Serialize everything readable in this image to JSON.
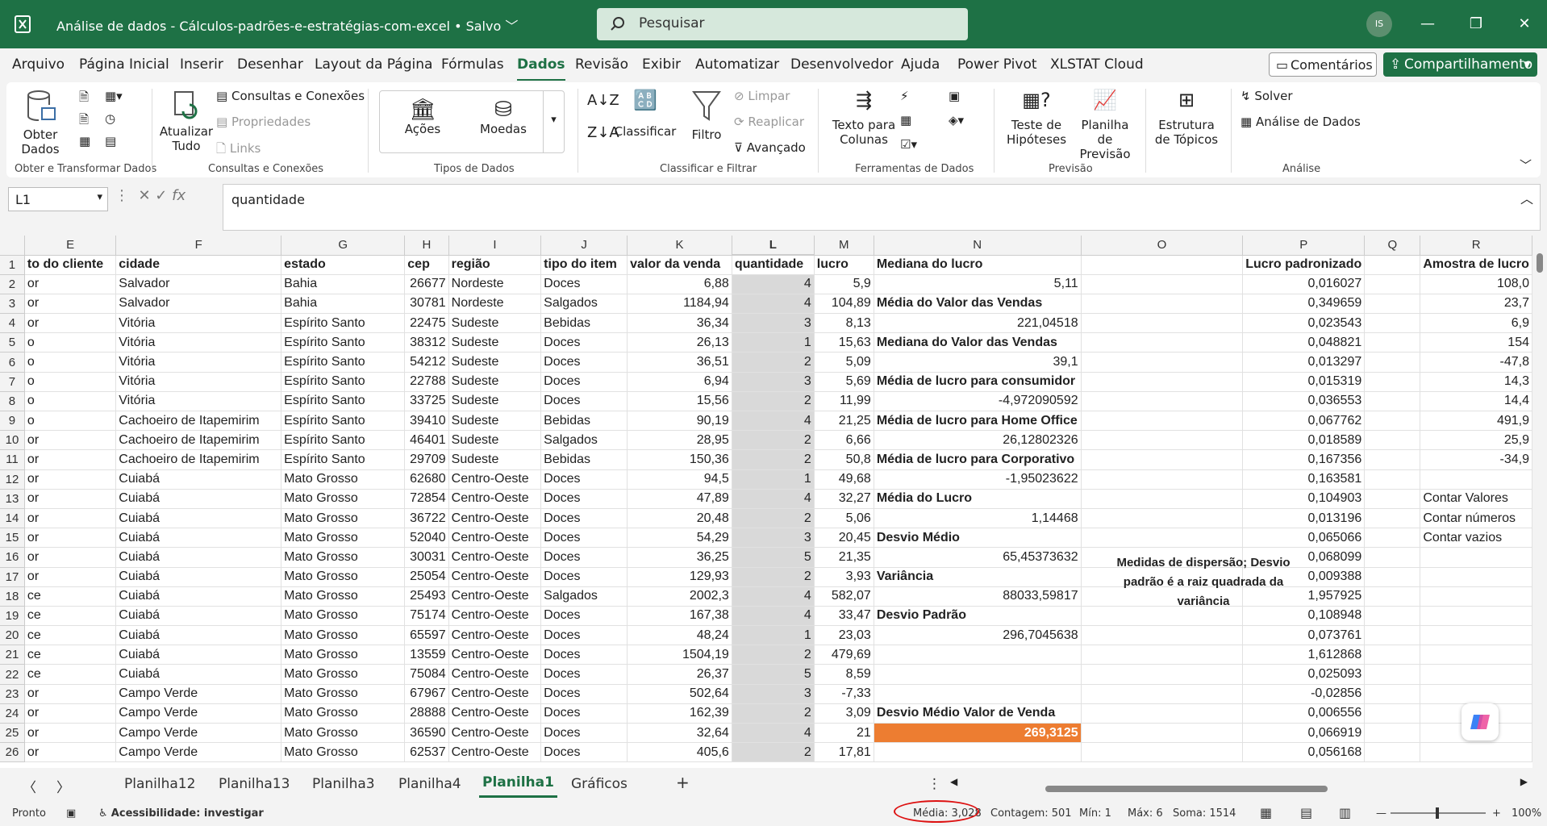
{
  "window": {
    "title": "Análise de dados - Cálculos-padrões-e-estratégias-com-excel • Salvo",
    "avatar": "IS"
  },
  "search": {
    "placeholder": "Pesquisar"
  },
  "menu": {
    "tabs": [
      "Arquivo",
      "Página Inicial",
      "Inserir",
      "Desenhar",
      "Layout da Página",
      "Fórmulas",
      "Dados",
      "Revisão",
      "Exibir",
      "Automatizar",
      "Desenvolvedor",
      "Ajuda",
      "Power Pivot",
      "XLSTAT Cloud"
    ],
    "active": "Dados",
    "comments": "Comentários",
    "share": "Compartilhamento"
  },
  "ribbon": {
    "get_data": "Obter Dados",
    "refresh_all": "Atualizar Tudo",
    "queries": "Consultas e Conexões",
    "properties": "Propriedades",
    "links": "Links",
    "stocks": "Ações",
    "currencies": "Moedas",
    "sort": "Classificar",
    "filter": "Filtro",
    "clear": "Limpar",
    "reapply": "Reaplicar",
    "advanced": "Avançado",
    "text_to_columns": "Texto para Colunas",
    "what_if": "Teste de Hipóteses",
    "forecast": "Planilha de Previsão",
    "outline": "Estrutura de Tópicos",
    "solver": "Solver",
    "data_analysis": "Análise de Dados",
    "groups": [
      "Obter e Transformar Dados",
      "Consultas e Conexões",
      "Tipos de Dados",
      "Classificar e Filtrar",
      "Ferramentas de Dados",
      "Previsão",
      "Análise"
    ]
  },
  "formula_bar": {
    "name_box": "L1",
    "formula": "quantidade"
  },
  "sheet": {
    "columns": [
      "E",
      "F",
      "G",
      "H",
      "I",
      "J",
      "K",
      "L",
      "M",
      "N",
      "O",
      "P",
      "Q",
      "R"
    ],
    "selected_column": "L",
    "rows": [
      [
        "to do cliente",
        "cidade",
        "estado",
        "cep",
        "região",
        "tipo do item",
        "valor da venda",
        "quantidade",
        "lucro",
        "Mediana do lucro",
        "",
        "Lucro padronizado",
        "",
        "Amostra de lucro"
      ],
      [
        "or",
        "Salvador",
        "Bahia",
        "26677",
        "Nordeste",
        "Doces",
        "6,88",
        "4",
        "5,9",
        "5,11",
        "",
        "0,016027",
        "",
        "108,0"
      ],
      [
        "or",
        "Salvador",
        "Bahia",
        "30781",
        "Nordeste",
        "Salgados",
        "1184,94",
        "4",
        "104,89",
        "Média do Valor das Vendas",
        "",
        "0,349659",
        "",
        "23,7"
      ],
      [
        "or",
        "Vitória",
        "Espírito Santo",
        "22475",
        "Sudeste",
        "Bebidas",
        "36,34",
        "3",
        "8,13",
        "221,04518",
        "",
        "0,023543",
        "",
        "6,9"
      ],
      [
        "o",
        "Vitória",
        "Espírito Santo",
        "38312",
        "Sudeste",
        "Doces",
        "26,13",
        "1",
        "15,63",
        "Mediana do Valor das Vendas",
        "",
        "0,048821",
        "",
        "154"
      ],
      [
        "o",
        "Vitória",
        "Espírito Santo",
        "54212",
        "Sudeste",
        "Doces",
        "36,51",
        "2",
        "5,09",
        "39,1",
        "",
        "0,013297",
        "",
        "-47,8"
      ],
      [
        "o",
        "Vitória",
        "Espírito Santo",
        "22788",
        "Sudeste",
        "Doces",
        "6,94",
        "3",
        "5,69",
        "Média de lucro para consumidor",
        "",
        "0,015319",
        "",
        "14,3"
      ],
      [
        "o",
        "Vitória",
        "Espírito Santo",
        "33725",
        "Sudeste",
        "Doces",
        "15,56",
        "2",
        "11,99",
        "-4,972090592",
        "",
        "0,036553",
        "",
        "14,4"
      ],
      [
        "o",
        "Cachoeiro de Itapemirim",
        "Espírito Santo",
        "39410",
        "Sudeste",
        "Bebidas",
        "90,19",
        "4",
        "21,25",
        "Média de lucro para Home Office",
        "",
        "0,067762",
        "",
        "491,9"
      ],
      [
        "or",
        "Cachoeiro de Itapemirim",
        "Espírito Santo",
        "46401",
        "Sudeste",
        "Salgados",
        "28,95",
        "2",
        "6,66",
        "26,12802326",
        "",
        "0,018589",
        "",
        "25,9"
      ],
      [
        "or",
        "Cachoeiro de Itapemirim",
        "Espírito Santo",
        "29709",
        "Sudeste",
        "Bebidas",
        "150,36",
        "2",
        "50,8",
        "Média de lucro para Corporativo",
        "",
        "0,167356",
        "",
        "-34,9"
      ],
      [
        "or",
        "Cuiabá",
        "Mato Grosso",
        "62680",
        "Centro-Oeste",
        "Doces",
        "94,5",
        "1",
        "49,68",
        "-1,95023622",
        "",
        "0,163581",
        "",
        ""
      ],
      [
        "or",
        "Cuiabá",
        "Mato Grosso",
        "72854",
        "Centro-Oeste",
        "Doces",
        "47,89",
        "4",
        "32,27",
        "Média do Lucro",
        "",
        "0,104903",
        "",
        "Contar Valores"
      ],
      [
        "or",
        "Cuiabá",
        "Mato Grosso",
        "36722",
        "Centro-Oeste",
        "Doces",
        "20,48",
        "2",
        "5,06",
        "1,14468",
        "",
        "0,013196",
        "",
        "Contar números"
      ],
      [
        "or",
        "Cuiabá",
        "Mato Grosso",
        "52040",
        "Centro-Oeste",
        "Doces",
        "54,29",
        "3",
        "20,45",
        "Desvio Médio",
        "",
        "0,065066",
        "",
        "Contar vazios"
      ],
      [
        "or",
        "Cuiabá",
        "Mato Grosso",
        "30031",
        "Centro-Oeste",
        "Doces",
        "36,25",
        "5",
        "21,35",
        "65,45373632",
        "",
        "0,068099",
        "",
        ""
      ],
      [
        "or",
        "Cuiabá",
        "Mato Grosso",
        "25054",
        "Centro-Oeste",
        "Doces",
        "129,93",
        "2",
        "3,93",
        "Variância",
        "",
        "0,009388",
        "",
        ""
      ],
      [
        "ce",
        "Cuiabá",
        "Mato Grosso",
        "25493",
        "Centro-Oeste",
        "Salgados",
        "2002,3",
        "4",
        "582,07",
        "88033,59817",
        "",
        "1,957925",
        "",
        ""
      ],
      [
        "ce",
        "Cuiabá",
        "Mato Grosso",
        "75174",
        "Centro-Oeste",
        "Doces",
        "167,38",
        "4",
        "33,47",
        "Desvio Padrão",
        "",
        "0,108948",
        "",
        ""
      ],
      [
        "ce",
        "Cuiabá",
        "Mato Grosso",
        "65597",
        "Centro-Oeste",
        "Doces",
        "48,24",
        "1",
        "23,03",
        "296,7045638",
        "",
        "0,073761",
        "",
        ""
      ],
      [
        "ce",
        "Cuiabá",
        "Mato Grosso",
        "13559",
        "Centro-Oeste",
        "Doces",
        "1504,19",
        "2",
        "479,69",
        "",
        "",
        "1,612868",
        "",
        ""
      ],
      [
        "ce",
        "Cuiabá",
        "Mato Grosso",
        "75084",
        "Centro-Oeste",
        "Doces",
        "26,37",
        "5",
        "8,59",
        "",
        "",
        "0,025093",
        "",
        ""
      ],
      [
        "or",
        "Campo Verde",
        "Mato Grosso",
        "67967",
        "Centro-Oeste",
        "Doces",
        "502,64",
        "3",
        "-7,33",
        "",
        "",
        "-0,02856",
        "",
        ""
      ],
      [
        "or",
        "Campo Verde",
        "Mato Grosso",
        "28888",
        "Centro-Oeste",
        "Doces",
        "162,39",
        "2",
        "3,09",
        "Desvio Médio Valor de Venda",
        "",
        "0,006556",
        "",
        ""
      ],
      [
        "or",
        "Campo Verde",
        "Mato Grosso",
        "36590",
        "Centro-Oeste",
        "Doces",
        "32,64",
        "4",
        "21",
        "269,3125",
        "",
        "0,066919",
        "",
        ""
      ],
      [
        "or",
        "Campo Verde",
        "Mato Grosso",
        "62537",
        "Centro-Oeste",
        "Doces",
        "405,6",
        "2",
        "17,81",
        "",
        "",
        "0,056168",
        "",
        ""
      ]
    ],
    "note": "Medidas de dispersão; Desvio padrão é a raiz quadrada da variância"
  },
  "sheet_tabs": {
    "tabs": [
      "Planilha12",
      "Planilha13",
      "Planilha3",
      "Planilha4",
      "Planilha1",
      "Gráficos"
    ],
    "active": "Planilha1"
  },
  "status": {
    "ready": "Pronto",
    "accessibility": "Acessibilidade: investigar",
    "average": "Média: 3,028",
    "count": "Contagem: 501",
    "min": "Mín: 1",
    "max": "Máx: 6",
    "sum": "Soma: 1514",
    "zoom": "100%"
  },
  "colors": {
    "accent": "#1e7145",
    "highlight": "#ed7d31",
    "annotation": "#dd1111"
  }
}
